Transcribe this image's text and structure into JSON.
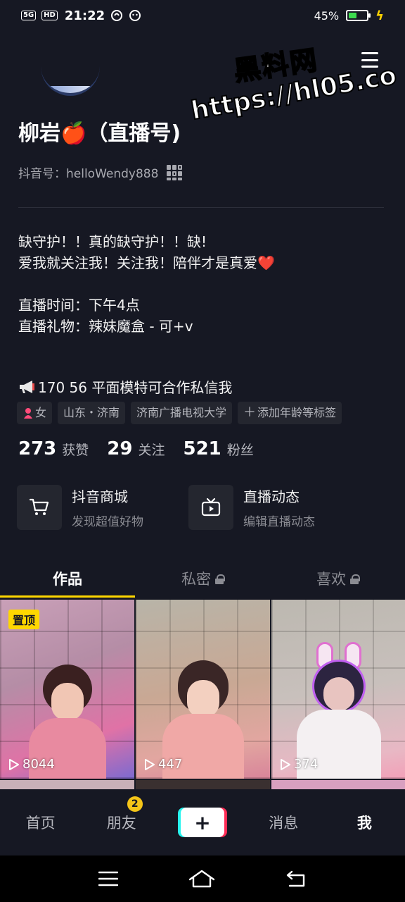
{
  "status_bar": {
    "network": "5G",
    "hd": "HD",
    "time": "21:22",
    "battery_percent": "45%",
    "battery_level": 0.45
  },
  "watermark": {
    "line1": "黑料网",
    "line2": "https://hl05.co"
  },
  "profile": {
    "name": "柳岩🍎（直播号)",
    "douyin_id": "抖音号：helloWendy888",
    "bio": [
      "缺守护！！真的缺守护！！缺!",
      "爱我就关注我！关注我！陪伴才是真爱❤️",
      "",
      "直播时间：下午4点",
      "直播礼物：辣妹魔盒 - 可+v"
    ],
    "announcement": "170   56 平面模特可合作私信我",
    "tags": [
      {
        "label": "女"
      },
      {
        "label": "山东・济南"
      },
      {
        "label": "济南广播电视大学"
      },
      {
        "label": "添加年龄等标签"
      }
    ],
    "stats": [
      {
        "value": "273",
        "label": "获赞"
      },
      {
        "value": "29",
        "label": "关注"
      },
      {
        "value": "521",
        "label": "粉丝"
      }
    ]
  },
  "features": [
    {
      "title": "抖音商城",
      "subtitle": "发现超值好物",
      "icon": "cart-icon"
    },
    {
      "title": "直播动态",
      "subtitle": "编辑直播动态",
      "icon": "live-tv-icon"
    }
  ],
  "tabs": [
    {
      "label": "作品",
      "active": true
    },
    {
      "label": "私密",
      "locked": true
    },
    {
      "label": "喜欢",
      "locked": true
    }
  ],
  "videos": [
    {
      "plays": "8044",
      "pinned_label": "置顶"
    },
    {
      "plays": "447"
    },
    {
      "plays": "374"
    }
  ],
  "bottom_nav": {
    "home": "首页",
    "friends": "朋友",
    "friends_badge": "2",
    "create": "+",
    "messages": "消息",
    "me": "我"
  },
  "colors": {
    "background": "#161823",
    "accent": "#fed700",
    "cyan": "#26f4ee",
    "red": "#fe2c55"
  }
}
